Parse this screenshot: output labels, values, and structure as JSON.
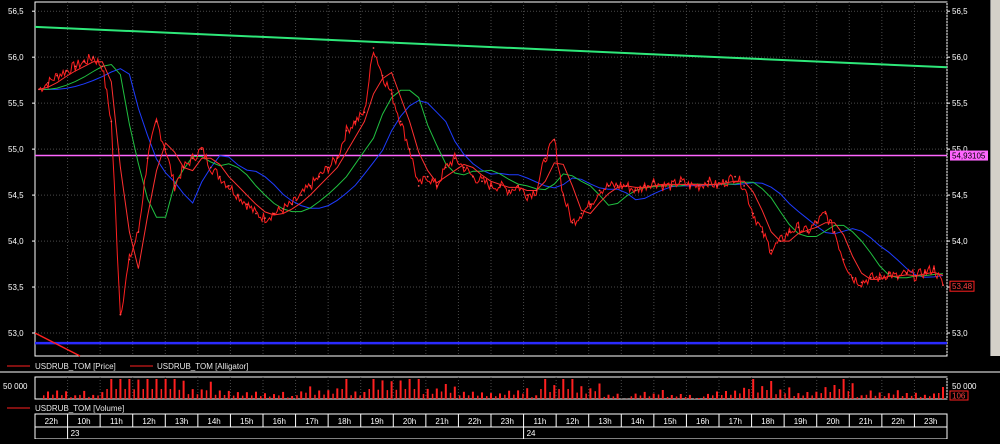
{
  "chart_data": [
    {
      "type": "line",
      "symbol": "USDRUB_TOM",
      "legend": [
        "USDRUB_TOM [Price]",
        "USDRUB_TOM [Alligator]"
      ],
      "ylim": [
        52.75,
        56.6
      ],
      "y_ticks": [
        "56,5",
        "56,0",
        "55,5",
        "55,0",
        "54,5",
        "54,0",
        "53,5",
        "53,0"
      ],
      "y_tick_values": [
        56.5,
        56.0,
        55.5,
        55.0,
        54.5,
        54.0,
        53.5,
        53.0
      ],
      "series": [
        {
          "name": "USDRUB_TOM [Price]",
          "color": "#ff2020",
          "x": [
            0,
            1,
            2,
            3,
            4,
            5,
            6,
            7,
            8,
            9,
            10,
            11,
            12,
            13,
            14,
            15,
            16,
            17,
            18,
            19,
            20,
            21,
            22,
            23,
            24,
            25,
            26,
            27,
            28,
            29,
            30,
            31,
            32,
            33,
            34,
            35,
            36,
            37,
            38,
            39,
            40,
            41,
            42,
            43,
            44,
            45,
            46,
            47,
            48,
            49,
            50,
            51,
            52,
            53,
            54,
            55,
            56,
            57,
            58,
            59,
            60,
            61,
            62,
            63,
            64,
            65,
            66,
            67,
            68,
            69,
            70,
            71,
            72,
            73,
            74,
            75,
            76,
            77,
            78,
            79,
            80,
            81,
            82,
            83,
            84,
            85,
            86,
            87,
            88,
            89,
            90,
            91,
            92,
            93,
            94,
            95,
            96,
            97,
            98,
            99,
            100
          ],
          "values": [
            55.65,
            55.72,
            55.8,
            55.85,
            55.9,
            55.95,
            56.0,
            55.9,
            55.3,
            53.2,
            53.8,
            54.1,
            54.9,
            55.3,
            55.0,
            54.6,
            54.8,
            54.9,
            55.0,
            54.8,
            54.7,
            54.6,
            54.5,
            54.4,
            54.3,
            54.25,
            54.3,
            54.35,
            54.4,
            54.5,
            54.6,
            54.7,
            54.8,
            54.9,
            55.2,
            55.3,
            55.4,
            56.1,
            55.8,
            55.6,
            55.3,
            55.0,
            54.6,
            54.7,
            54.6,
            54.8,
            54.9,
            54.8,
            54.7,
            54.65,
            54.6,
            54.6,
            54.55,
            54.6,
            54.5,
            54.55,
            54.9,
            55.1,
            54.5,
            54.2,
            54.3,
            54.4,
            54.55,
            54.6,
            54.6,
            54.6,
            54.55,
            54.6,
            54.65,
            54.6,
            54.6,
            54.65,
            54.6,
            54.6,
            54.65,
            54.6,
            54.65,
            54.7,
            54.6,
            54.3,
            54.1,
            53.9,
            54.0,
            54.1,
            54.15,
            54.1,
            54.2,
            54.3,
            54.1,
            53.8,
            53.6,
            53.55,
            53.6,
            53.6,
            53.65,
            53.6,
            53.65,
            53.62,
            53.66,
            53.7,
            53.52
          ]
        },
        {
          "name": "USDRUB_TOM [Alligator]",
          "colors": [
            "#1e3cff",
            "#20c040",
            "#ff3030"
          ]
        }
      ],
      "trendline": {
        "from": 56.33,
        "to": 55.89,
        "color": "#2ee87a"
      },
      "hline": {
        "value": 54.93,
        "label": "54,93105",
        "color": "#ff66ff"
      },
      "support_line": {
        "value": 52.89,
        "color": "#2a2aff"
      },
      "last_price_label": "53,48",
      "grid": true
    },
    {
      "type": "bar",
      "legend": [
        "USDRUB_TOM [Volume]"
      ],
      "y_ticks": [
        "50 000"
      ],
      "last_value_label": "106",
      "color": "#ff2020"
    }
  ],
  "time_axis": {
    "hours": [
      "22h",
      "10h",
      "11h",
      "12h",
      "13h",
      "14h",
      "15h",
      "16h",
      "17h",
      "18h",
      "19h",
      "20h",
      "21h",
      "22h",
      "23h",
      "11h",
      "12h",
      "13h",
      "14h",
      "15h",
      "16h",
      "17h",
      "18h",
      "19h",
      "20h",
      "21h",
      "22h",
      "23h"
    ],
    "days": [
      "23",
      "24"
    ]
  },
  "colors": {
    "background": "#000000",
    "grid": "#4a4a4a",
    "text": "#ffffff"
  }
}
